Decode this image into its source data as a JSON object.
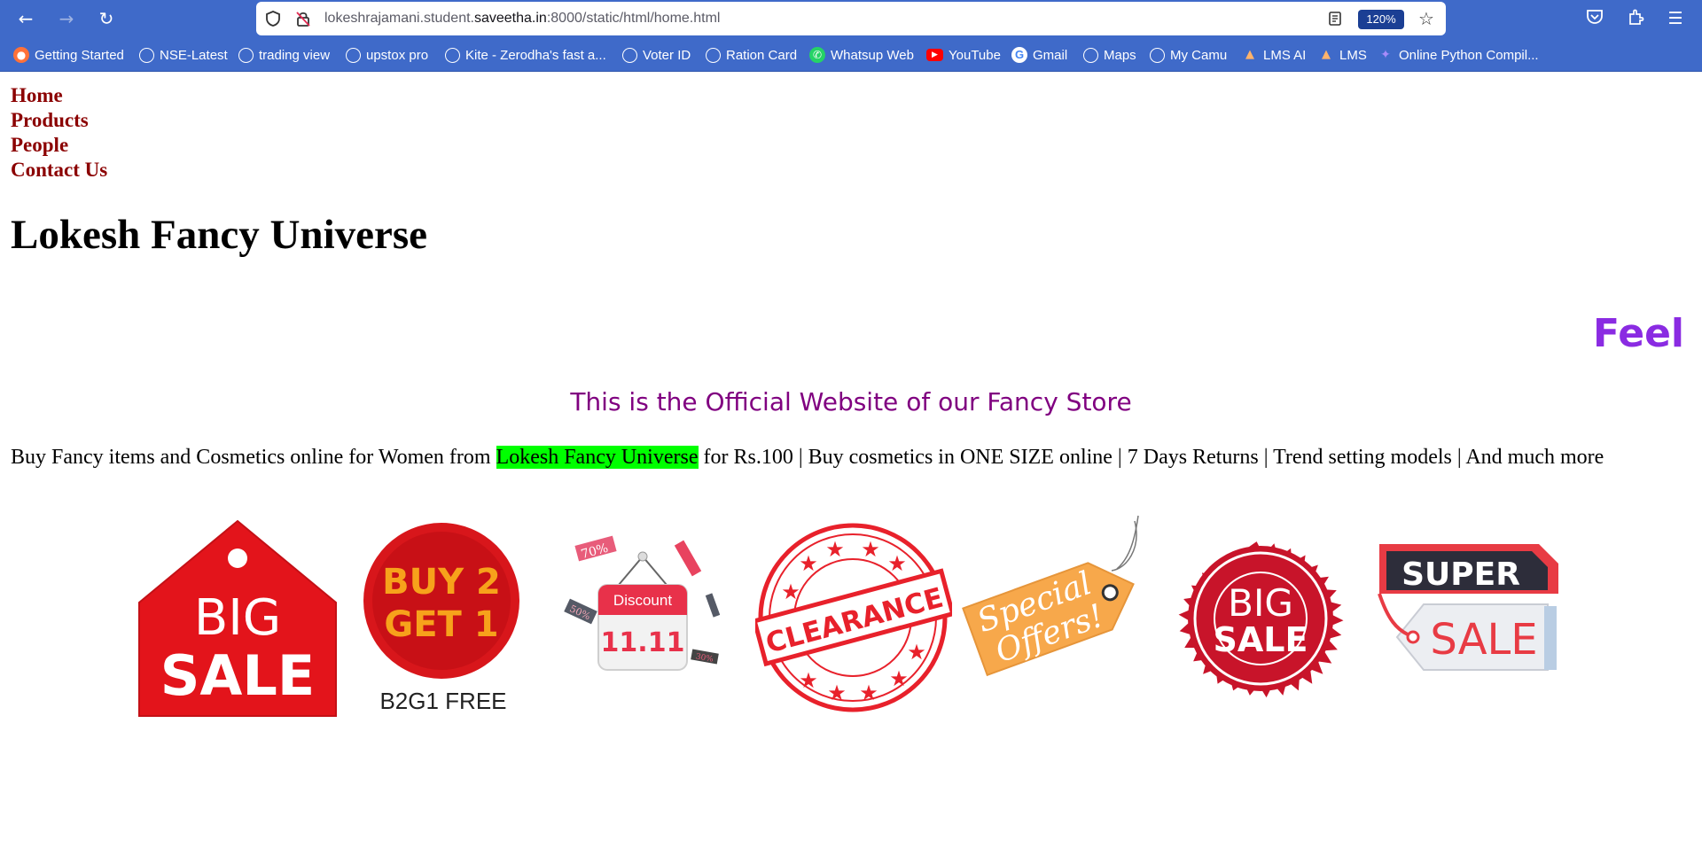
{
  "browser": {
    "url_prefix": "lokeshrajamani.student.",
    "url_domain": "saveetha.in",
    "url_suffix": ":8000/static/html/home.html",
    "zoom": "120%",
    "icons": {
      "back": "arrow-left-icon",
      "forward": "arrow-right-icon",
      "reload": "reload-icon",
      "shield": "shield-icon",
      "insecure": "insecure-lock-icon",
      "reader": "reader-view-icon",
      "bookmark": "star-icon",
      "pocket": "pocket-icon",
      "extensions": "extensions-icon",
      "menu": "hamburger-menu-icon"
    }
  },
  "bookmarks": [
    {
      "label": "Getting Started",
      "icon": "firefox-icon"
    },
    {
      "label": "NSE-Latest",
      "icon": "globe-icon"
    },
    {
      "label": "trading view",
      "icon": "globe-icon"
    },
    {
      "label": "upstox pro",
      "icon": "globe-icon"
    },
    {
      "label": "Kite - Zerodha's fast a...",
      "icon": "globe-icon"
    },
    {
      "label": "Voter ID",
      "icon": "globe-icon"
    },
    {
      "label": "Ration Card",
      "icon": "globe-icon"
    },
    {
      "label": "Whatsup Web",
      "icon": "whatsapp-icon"
    },
    {
      "label": "YouTube",
      "icon": "youtube-icon"
    },
    {
      "label": "Gmail",
      "icon": "google-icon"
    },
    {
      "label": "Maps",
      "icon": "globe-icon"
    },
    {
      "label": "My Camu",
      "icon": "globe-icon"
    },
    {
      "label": "LMS AI",
      "icon": "lms-icon"
    },
    {
      "label": "LMS",
      "icon": "lms-icon"
    },
    {
      "label": "Online Python Compil...",
      "icon": "python-compiler-icon"
    }
  ],
  "nav": {
    "home": "Home",
    "products": "Products",
    "people": "People",
    "contact": "Contact Us"
  },
  "page": {
    "title": "Lokesh Fancy Universe",
    "marquee": "Feel",
    "subtitle": "This is the Official Website of our Fancy Store",
    "tagline_before": "Buy Fancy items and Cosmetics online for Women from ",
    "tagline_highlight": "Lokesh Fancy Universe",
    "tagline_after": " for Rs.100 | Buy cosmetics in ONE SIZE online | 7 Days Returns | Trend setting models | And much more"
  },
  "badges": {
    "big_sale_tag": {
      "line1": "BIG",
      "line2": "SALE"
    },
    "b2g1": {
      "line1": "BUY 2",
      "line2": "GET 1",
      "caption": "B2G1 FREE"
    },
    "discount": {
      "label": "Discount",
      "date": "11.11",
      "tag1": "70%",
      "tag2": "50%",
      "tag3": "30%"
    },
    "clearance": {
      "label": "CLEARANCE"
    },
    "special": {
      "line1": "Special",
      "line2": "Offers!"
    },
    "big_sale_seal": {
      "line1": "BIG",
      "line2": "SALE"
    },
    "super_sale": {
      "line1": "SUPER",
      "line2": "SALE"
    }
  }
}
